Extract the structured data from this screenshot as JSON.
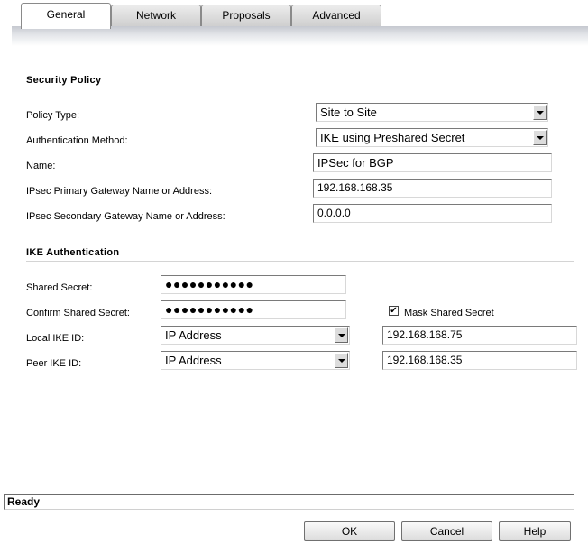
{
  "tabs": [
    {
      "label": "General",
      "active": true
    },
    {
      "label": "Network",
      "active": false
    },
    {
      "label": "Proposals",
      "active": false
    },
    {
      "label": "Advanced",
      "active": false
    }
  ],
  "security_policy": {
    "title": "Security Policy",
    "policy_type_label": "Policy Type:",
    "policy_type_value": "Site to Site",
    "auth_method_label": "Authentication Method:",
    "auth_method_value": "IKE using Preshared Secret",
    "name_label": "Name:",
    "name_value": "IPSec for BGP",
    "primary_gw_label": "IPsec Primary Gateway Name or Address:",
    "primary_gw_value": "192.168.168.35",
    "secondary_gw_label": "IPsec Secondary Gateway Name or Address:",
    "secondary_gw_value": "0.0.0.0"
  },
  "ike_auth": {
    "title": "IKE Authentication",
    "shared_secret_label": "Shared Secret:",
    "shared_secret_value": "●●●●●●●●●●●",
    "confirm_secret_label": "Confirm Shared Secret:",
    "confirm_secret_value": "●●●●●●●●●●●",
    "mask_label": "Mask Shared Secret",
    "mask_checked": true,
    "mask_checkmark": "✔",
    "local_ike_label": "Local IKE ID:",
    "local_ike_type": "IP Address",
    "local_ike_value": "192.168.168.75",
    "peer_ike_label": "Peer IKE ID:",
    "peer_ike_type": "IP Address",
    "peer_ike_value": "192.168.168.35"
  },
  "status": "Ready",
  "buttons": {
    "ok": "OK",
    "cancel": "Cancel",
    "help": "Help"
  }
}
